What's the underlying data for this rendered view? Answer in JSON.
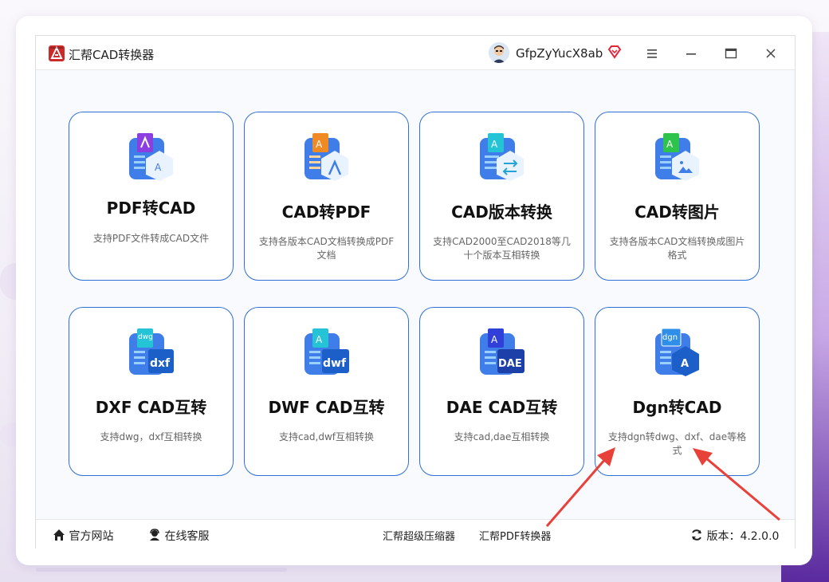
{
  "window": {
    "title": "汇帮CAD转换器",
    "username": "GfpZyYucX8ab"
  },
  "controls": {
    "menu_icon": "hamburger-icon",
    "minimize_icon": "minimize-icon",
    "maximize_icon": "maximize-icon",
    "close_icon": "close-icon"
  },
  "tiles": [
    {
      "title": "PDF转CAD",
      "desc": "支持PDF文件转成CAD文件",
      "icon": "pdf-to-cad-icon",
      "color": "#8b3fe0"
    },
    {
      "title": "CAD转PDF",
      "desc": "支持各版本CAD文档转换成PDF文档",
      "icon": "cad-to-pdf-icon",
      "color": "#f08a24"
    },
    {
      "title": "CAD版本转换",
      "desc": "支持CAD2000至CAD2018等几十个版本互相转换",
      "icon": "cad-version-convert-icon",
      "color": "#24c3d6"
    },
    {
      "title": "CAD转图片",
      "desc": "支持各版本CAD文档转换成图片格式",
      "icon": "cad-to-image-icon",
      "color": "#2ec34a"
    },
    {
      "title": "DXF CAD互转",
      "desc": "支持dwg，dxf互相转换",
      "icon": "dxf-cad-icon",
      "color": "#24c3d6"
    },
    {
      "title": "DWF CAD互转",
      "desc": "支持cad,dwf互相转换",
      "icon": "dwf-cad-icon",
      "color": "#24c3d6"
    },
    {
      "title": "DAE CAD互转",
      "desc": "支持cad,dae互相转换",
      "icon": "dae-cad-icon",
      "color": "#2f3fd8"
    },
    {
      "title": "Dgn转CAD",
      "desc": "支持dgn转dwg、dxf、dae等格式",
      "icon": "dgn-to-cad-icon",
      "color": "#2f8fe8"
    }
  ],
  "tile_icon_labels": {
    "dxf": "dxf",
    "dwf": "dwf",
    "dae": "DAE",
    "dgn_top": "dgn",
    "dwg_top": "dwg",
    "a_mark": "A"
  },
  "footer": {
    "website": "官方网站",
    "support": "在线客服",
    "compressor": "汇帮超级压缩器",
    "pdf_converter": "汇帮PDF转换器",
    "version_label": "版本：",
    "version": "4.2.0.0"
  },
  "colors": {
    "accent": "#2f6fd8",
    "annotation_arrow": "#e8413a"
  }
}
